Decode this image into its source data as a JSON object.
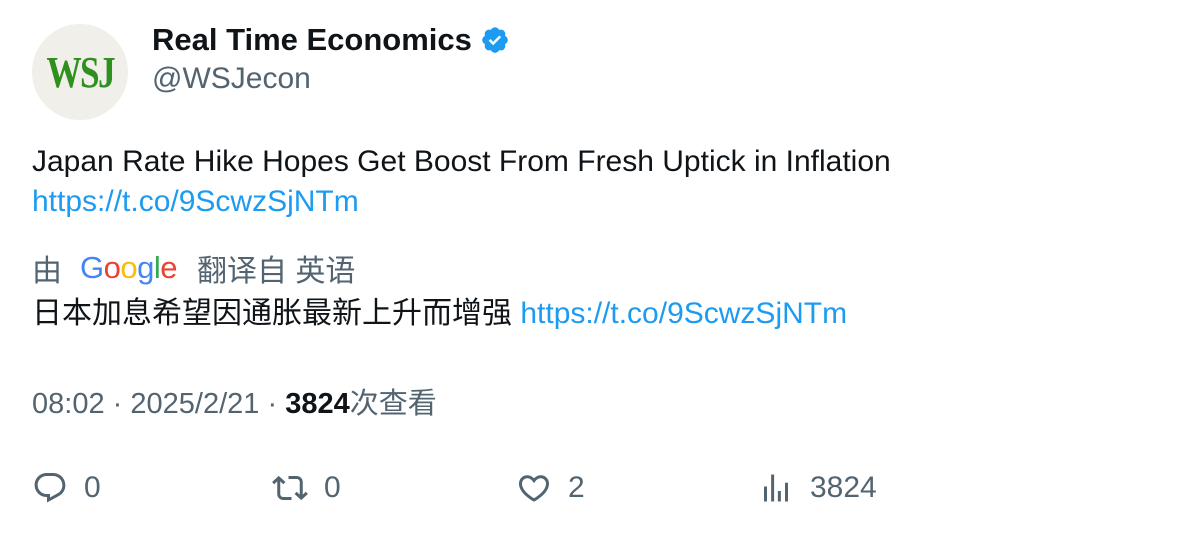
{
  "author": {
    "avatar_text": "WSJ",
    "display_name": "Real Time Economics",
    "handle": "@WSJecon",
    "verified": true
  },
  "tweet": {
    "text": "Japan Rate Hike Hopes Get Boost From Fresh Uptick in Inflation",
    "link": "https://t.co/9ScwzSjNTm"
  },
  "translation": {
    "prefix": "由",
    "provider": "Google",
    "suffix": "翻译自 英语",
    "text": "日本加息希望因通胀最新上升而增强",
    "link": "https://t.co/9ScwzSjNTm"
  },
  "meta": {
    "time": "08:02",
    "separator": "·",
    "date": "2025/2/21",
    "views_count": "3824",
    "views_label": "次查看"
  },
  "actions": {
    "reply_count": "0",
    "retweet_count": "0",
    "like_count": "2",
    "views_count": "3824"
  },
  "colors": {
    "link": "#1d9bf0",
    "secondary_text": "#536471",
    "primary_text": "#0f1419",
    "verified": "#1d9bf0",
    "wsj_green": "#2f8f1f"
  },
  "icons": [
    "verified-badge-icon",
    "reply-icon",
    "retweet-icon",
    "like-icon",
    "views-icon"
  ]
}
